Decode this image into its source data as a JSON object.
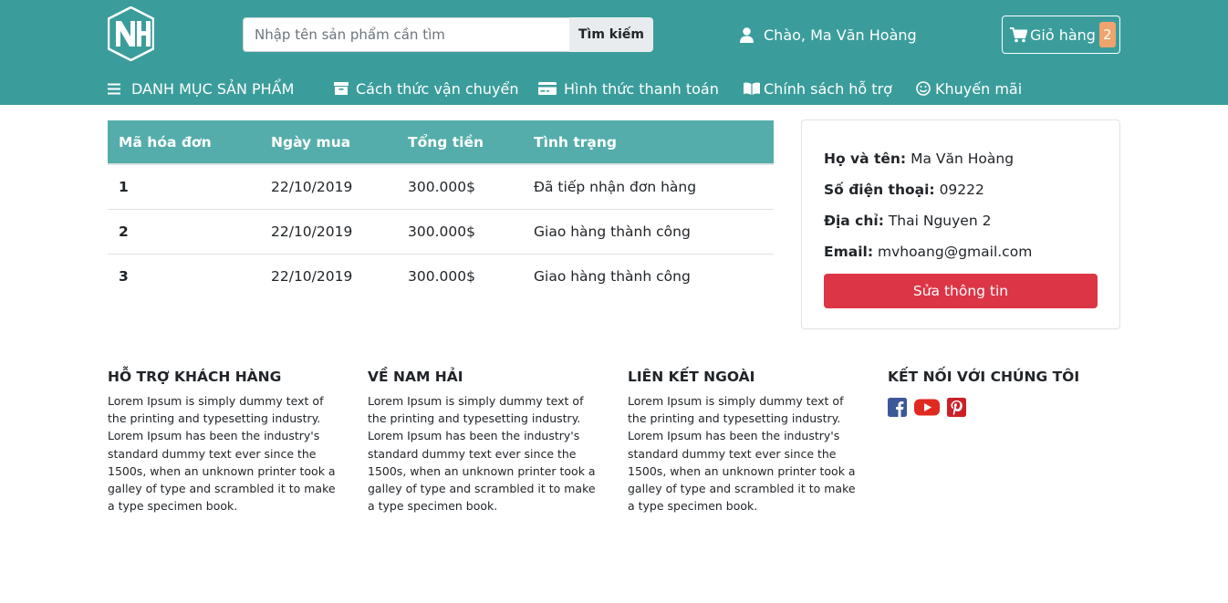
{
  "header": {
    "logo_text": "NH",
    "search": {
      "placeholder": "Nhập tên sản phẩm cần tìm",
      "button_label": "Tìm kiếm"
    },
    "greeting": "Chào, Ma Văn Hoàng",
    "cart": {
      "label": "Giỏ hàng",
      "count": "2"
    }
  },
  "nav": {
    "items": [
      {
        "label": "DANH MỤC SẢN PHẨM",
        "icon": "menu-icon"
      },
      {
        "label": "Cách thức vận chuyển",
        "icon": "archive-icon"
      },
      {
        "label": "Hình thức thanh toán",
        "icon": "credit-card-icon"
      },
      {
        "label": "Chính sách hỗ trợ",
        "icon": "book-icon"
      },
      {
        "label": "Khuyến mãi",
        "icon": "smile-icon"
      }
    ]
  },
  "orders": {
    "headers": [
      "Mã hóa đơn",
      "Ngày mua",
      "Tổng tiền",
      "Tình trạng"
    ],
    "rows": [
      {
        "id": "1",
        "date": "22/10/2019",
        "total": "300.000$",
        "status": "Đã tiếp nhận đơn hàng"
      },
      {
        "id": "2",
        "date": "22/10/2019",
        "total": "300.000$",
        "status": "Giao hàng thành công"
      },
      {
        "id": "3",
        "date": "22/10/2019",
        "total": "300.000$",
        "status": "Giao hàng thành công"
      }
    ]
  },
  "profile": {
    "name_label": "Họ và tên:",
    "name": "Ma Văn Hoàng",
    "phone_label": "Số điện thoại:",
    "phone": "09222",
    "address_label": "Địa chỉ:",
    "address": "Thai Nguyen 2",
    "email_label": "Email:",
    "email": "mvhoang@gmail.com",
    "edit_button": "Sửa thông tin"
  },
  "footer": {
    "columns": [
      {
        "title": "HỖ TRỢ KHÁCH HÀNG",
        "text": "Lorem Ipsum is simply dummy text of the printing and typesetting industry. Lorem Ipsum has been the industry's standard dummy text ever since the 1500s, when an unknown printer took a galley of type and scrambled it to make a type specimen book."
      },
      {
        "title": "VỀ NAM HẢI",
        "text": "Lorem Ipsum is simply dummy text of the printing and typesetting industry. Lorem Ipsum has been the industry's standard dummy text ever since the 1500s, when an unknown printer took a galley of type and scrambled it to make a type specimen book."
      },
      {
        "title": "LIÊN KẾT NGOÀI",
        "text": "Lorem Ipsum is simply dummy text of the printing and typesetting industry. Lorem Ipsum has been the industry's standard dummy text ever since the 1500s, when an unknown printer took a galley of type and scrambled it to make a type specimen book."
      },
      {
        "title": "KẾT NỐI VỚI CHÚNG TÔI",
        "social": [
          "facebook-icon",
          "youtube-icon",
          "pinterest-icon"
        ]
      }
    ]
  },
  "colors": {
    "header_bg": "#3a9d9b",
    "table_header_bg": "#54adaa",
    "cart_badge": "#f0a36c",
    "edit_button": "#dc3545",
    "facebook": "#3b5998",
    "youtube": "#e02a20",
    "pinterest": "#cb2027"
  }
}
